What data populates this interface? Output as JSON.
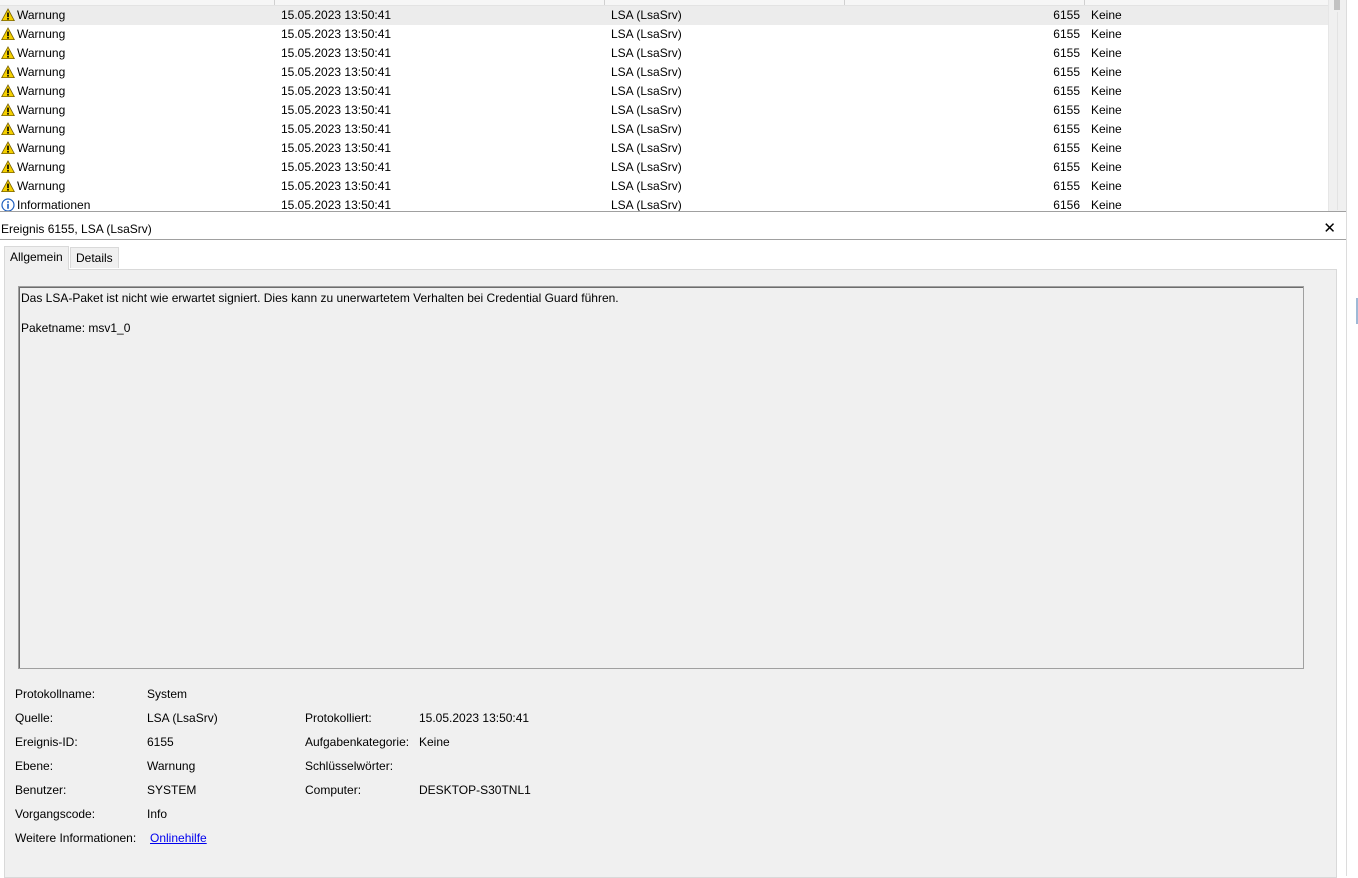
{
  "events": {
    "rows": [
      {
        "level": "Warnung",
        "icon": "warning-icon",
        "date": "15.05.2023 13:50:41",
        "source": "LSA (LsaSrv)",
        "id": "6155",
        "category": "Keine",
        "selected": true
      },
      {
        "level": "Warnung",
        "icon": "warning-icon",
        "date": "15.05.2023 13:50:41",
        "source": "LSA (LsaSrv)",
        "id": "6155",
        "category": "Keine"
      },
      {
        "level": "Warnung",
        "icon": "warning-icon",
        "date": "15.05.2023 13:50:41",
        "source": "LSA (LsaSrv)",
        "id": "6155",
        "category": "Keine"
      },
      {
        "level": "Warnung",
        "icon": "warning-icon",
        "date": "15.05.2023 13:50:41",
        "source": "LSA (LsaSrv)",
        "id": "6155",
        "category": "Keine"
      },
      {
        "level": "Warnung",
        "icon": "warning-icon",
        "date": "15.05.2023 13:50:41",
        "source": "LSA (LsaSrv)",
        "id": "6155",
        "category": "Keine"
      },
      {
        "level": "Warnung",
        "icon": "warning-icon",
        "date": "15.05.2023 13:50:41",
        "source": "LSA (LsaSrv)",
        "id": "6155",
        "category": "Keine"
      },
      {
        "level": "Warnung",
        "icon": "warning-icon",
        "date": "15.05.2023 13:50:41",
        "source": "LSA (LsaSrv)",
        "id": "6155",
        "category": "Keine"
      },
      {
        "level": "Warnung",
        "icon": "warning-icon",
        "date": "15.05.2023 13:50:41",
        "source": "LSA (LsaSrv)",
        "id": "6155",
        "category": "Keine"
      },
      {
        "level": "Warnung",
        "icon": "warning-icon",
        "date": "15.05.2023 13:50:41",
        "source": "LSA (LsaSrv)",
        "id": "6155",
        "category": "Keine"
      },
      {
        "level": "Warnung",
        "icon": "warning-icon",
        "date": "15.05.2023 13:50:41",
        "source": "LSA (LsaSrv)",
        "id": "6155",
        "category": "Keine"
      },
      {
        "level": "Informationen",
        "icon": "info-icon",
        "date": "15.05.2023 13:50:41",
        "source": "LSA (LsaSrv)",
        "id": "6156",
        "category": "Keine"
      }
    ]
  },
  "detail": {
    "title": "Ereignis 6155, LSA (LsaSrv)",
    "close_glyph": "✕",
    "tabs": [
      {
        "label": "Allgemein"
      },
      {
        "label": "Details"
      }
    ],
    "message_line1": "Das LSA-Paket ist nicht wie erwartet signiert. Dies kann zu unerwartetem Verhalten bei Credential Guard führen.",
    "message_line2": "Paketname: msv1_0",
    "fields": {
      "log_name_label": "Protokollname:",
      "log_name": "System",
      "source_label": "Quelle:",
      "source": "LSA (LsaSrv)",
      "logged_label": "Protokolliert:",
      "logged": "15.05.2023 13:50:41",
      "event_id_label": "Ereignis-ID:",
      "event_id": "6155",
      "task_category_label": "Aufgabenkategorie:",
      "task_category": "Keine",
      "level_label": "Ebene:",
      "level": "Warnung",
      "keywords_label": "Schlüsselwörter:",
      "keywords": "",
      "user_label": "Benutzer:",
      "user": "SYSTEM",
      "computer_label": "Computer:",
      "computer": "DESKTOP-S30TNL1",
      "opcode_label": "Vorgangscode:",
      "opcode": "Info",
      "more_info_label": "Weitere Informationen:",
      "more_info_link": "Onlinehilfe"
    }
  },
  "colors": {
    "selection": "#ececec",
    "link": "#0000ee",
    "warning": "#f5d000",
    "info": "#1f5fbf"
  }
}
